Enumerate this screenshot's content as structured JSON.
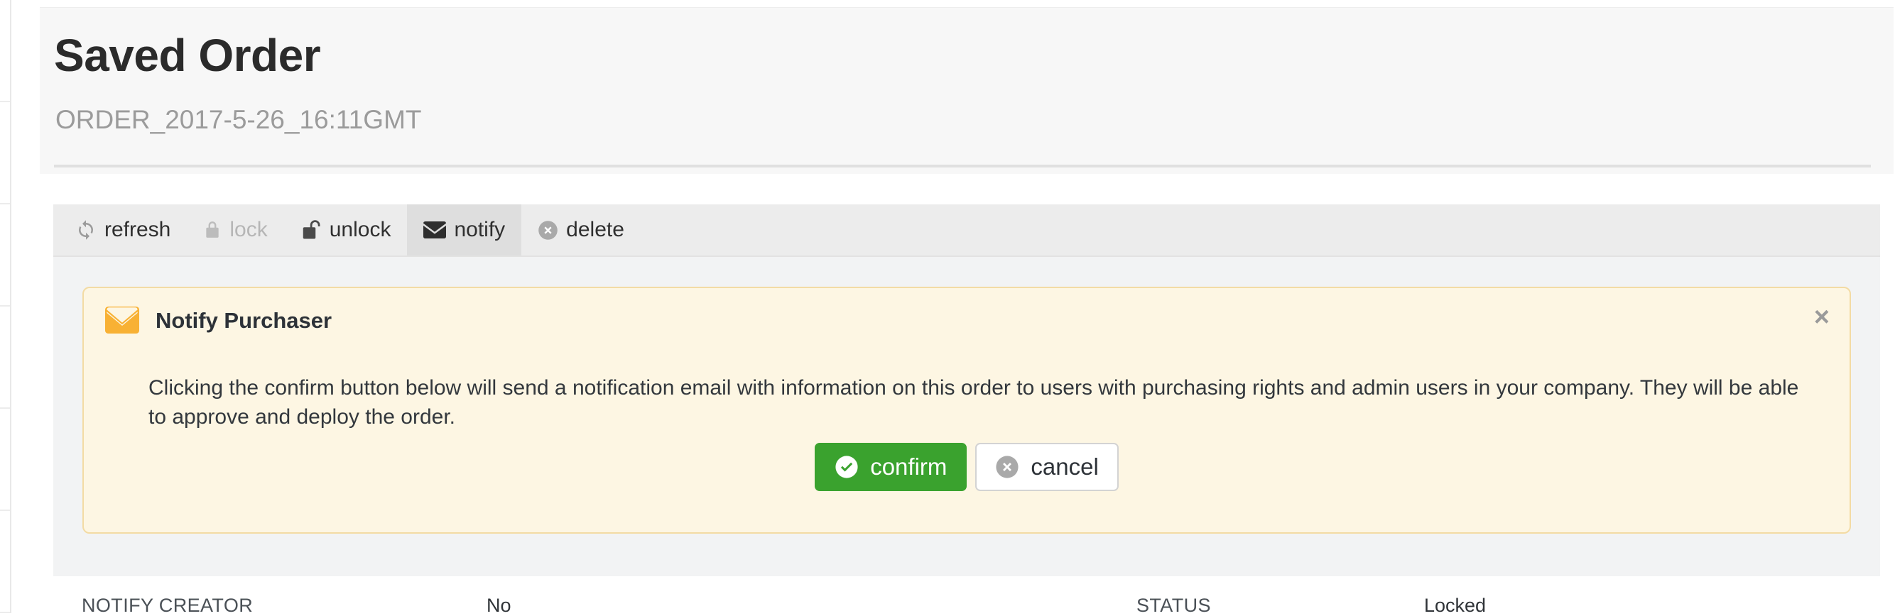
{
  "header": {
    "title": "Saved Order",
    "subtitle": "ORDER_2017-5-26_16:11GMT"
  },
  "toolbar": {
    "items": [
      {
        "label": "refresh",
        "icon": "refresh-icon",
        "state": "enabled"
      },
      {
        "label": "lock",
        "icon": "lock-icon",
        "state": "disabled"
      },
      {
        "label": "unlock",
        "icon": "unlock-icon",
        "state": "enabled"
      },
      {
        "label": "notify",
        "icon": "envelope-icon",
        "state": "active"
      },
      {
        "label": "delete",
        "icon": "delete-circle-icon",
        "state": "enabled"
      }
    ]
  },
  "alert": {
    "icon": "envelope-icon",
    "title": "Notify Purchaser",
    "message": "Clicking the confirm button below will send a notification email with information on this order to users with purchasing rights and admin users in your company. They will be able to approve and deploy the order.",
    "close_label": "×",
    "confirm_label": "confirm",
    "confirm_icon": "check-circle-icon",
    "cancel_label": "cancel",
    "cancel_icon": "x-circle-icon"
  },
  "details": {
    "fields": [
      {
        "label": "NOTIFY CREATOR",
        "value": "No"
      },
      {
        "label": "STATUS",
        "value": "Locked"
      }
    ]
  },
  "colors": {
    "header_bg": "#f7f7f7",
    "toolbar_bg": "#ececec",
    "toolbar_active_bg": "#dedede",
    "panel_bg": "#f2f3f4",
    "alert_bg": "#fdf6e3",
    "alert_border": "#f3dba4",
    "alert_icon": "#f8b134",
    "confirm_green": "#3aa22e",
    "cancel_grey": "#9b9b9b",
    "title_text": "#2b2b2b",
    "subtitle_text": "#9b9b9b"
  }
}
